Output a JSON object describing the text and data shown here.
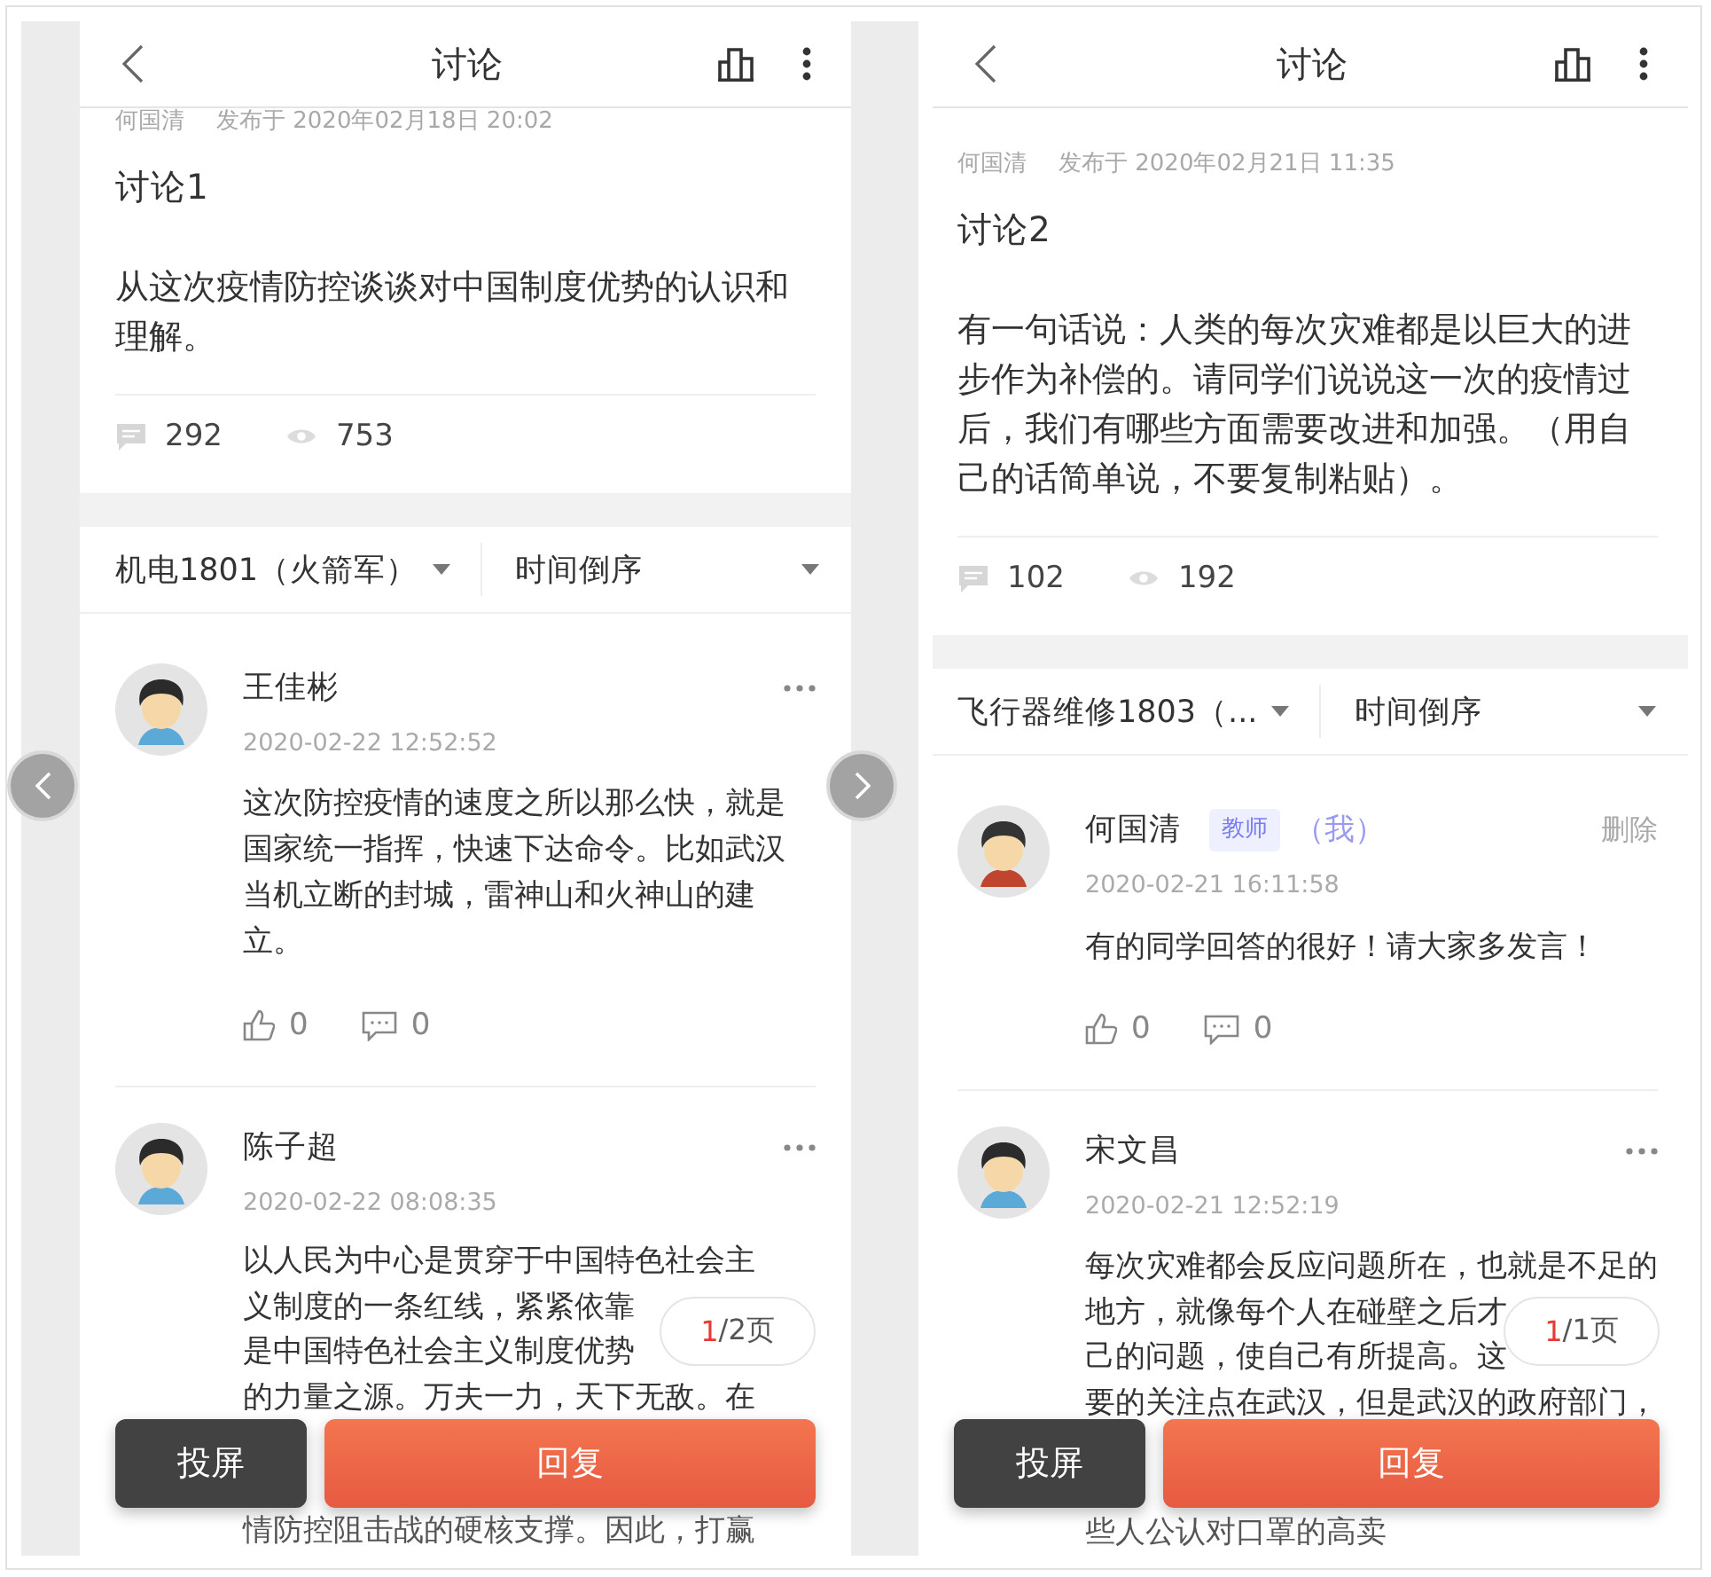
{
  "screens": [
    {
      "header": {
        "title": "讨论"
      },
      "post": {
        "author": "何国清",
        "published": "发布于 2020年02月18日 20:02",
        "title": "讨论1",
        "description": "从这次疫情防控谈谈对中国制度优势的认识和理解。",
        "reply_count": "292",
        "view_count": "753"
      },
      "filters": [
        {
          "label": "机电1801（火箭军）"
        },
        {
          "label": "时间倒序"
        }
      ],
      "comments": [
        {
          "author": "王佳彬",
          "kind": "student",
          "time": "2020-02-22 12:52:52",
          "action": {
            "kind": "more"
          },
          "body": "这次防控疫情的速度之所以那么快，就是国家统一指挥，快速下达命令。比如武汉当机立断的封城，雷神山和火神山的建立。",
          "likes": "0",
          "replies": "0"
        },
        {
          "author": "陈子超",
          "kind": "student",
          "time": "2020-02-22 08:08:35",
          "action": {
            "kind": "more"
          },
          "lines": [
            "以人民为中心是贯穿于中国特色社会主",
            "义制度的一条红线，紧紧依靠",
            "是中国特色社会主义制度优势",
            "的力量之源。万夫一力，天下无敌。在"
          ]
        }
      ],
      "pager": {
        "current": "1",
        "suffix": "/2页"
      },
      "buttons": [
        {
          "label": "投屏",
          "kind": "cast"
        },
        {
          "label": "回复",
          "kind": "reply"
        }
      ],
      "text_below_buttons": "情防控阻击战的硬核支撑。因此，打赢"
    },
    {
      "header": {
        "title": "讨论"
      },
      "post": {
        "author": "何国清",
        "published": "发布于 2020年02月21日 11:35",
        "title": "讨论2",
        "description": "有一句话说：人类的每次灾难都是以巨大的进步作为补偿的。请同学们说说这一次的疫情过后，我们有哪些方面需要改进和加强。（用自己的话简单说，不要复制粘贴）。",
        "reply_count": "102",
        "view_count": "192"
      },
      "filters": [
        {
          "label": "飞行器维修1803（..."
        },
        {
          "label": "时间倒序"
        }
      ],
      "comments": [
        {
          "author": "何国清",
          "role": "教师",
          "me_label": "（我）",
          "kind": "teacher",
          "time": "2020-02-21 16:11:58",
          "action": {
            "kind": "delete",
            "label": "删除"
          },
          "body": "有的同学回答的很好！请大家多发言！",
          "likes": "0",
          "replies": "0"
        },
        {
          "author": "宋文昌",
          "kind": "student",
          "time": "2020-02-21 12:52:19",
          "action": {
            "kind": "more"
          },
          "lines": [
            "每次灾难都会反应问题所在，也就是不足的",
            "地方，就像每个人在碰壁之后才",
            "己的问题，使自己有所提高。这",
            "要的关注点在武汉，但是武汉的政府部门，"
          ]
        }
      ],
      "pager": {
        "current": "1",
        "suffix": "/1页"
      },
      "buttons": [
        {
          "label": "投屏",
          "kind": "cast"
        },
        {
          "label": "回复",
          "kind": "reply"
        }
      ],
      "text_below_buttons": "些人公认对口罩的高卖"
    }
  ]
}
